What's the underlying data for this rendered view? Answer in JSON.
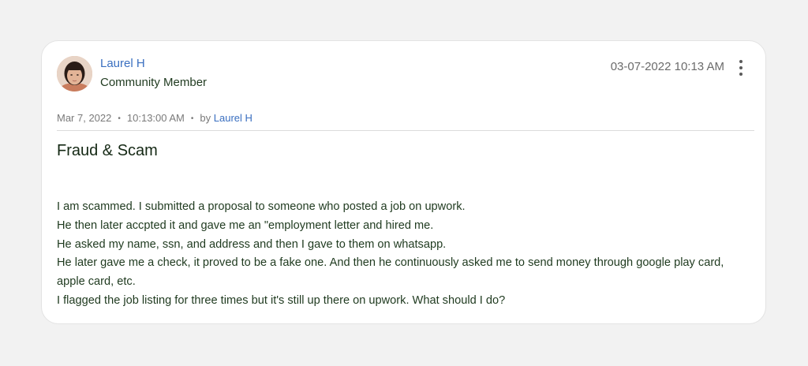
{
  "post": {
    "author": {
      "name": "Laurel H",
      "role": "Community Member",
      "avatar_icon": "user-avatar-photo"
    },
    "timestamp": "03-07-2022 10:13 AM",
    "menu_icon": "more-vertical-icon",
    "meta": {
      "date": "Mar 7, 2022",
      "time": "10:13:00 AM",
      "by_label": "by",
      "by_name": "Laurel H"
    },
    "title": "Fraud & Scam",
    "body_lines": [
      "I am scammed. I submitted a proposal to someone who posted a job on upwork.",
      "He then later accpted it and gave me an \"employment letter and hired me.",
      "He asked my name, ssn, and address and then I gave to them on whatsapp.",
      "He later gave me a check, it proved to be a fake one. And then he continuously asked me to send money through google play card, apple card, etc.",
      "I flagged the job listing for three times but it's still up there on upwork. What should I do?"
    ]
  },
  "colors": {
    "background": "#f2f2f2",
    "card": "#ffffff",
    "link": "#3a6fc0",
    "text": "#1f3a1f",
    "muted": "#7a7a7a"
  }
}
